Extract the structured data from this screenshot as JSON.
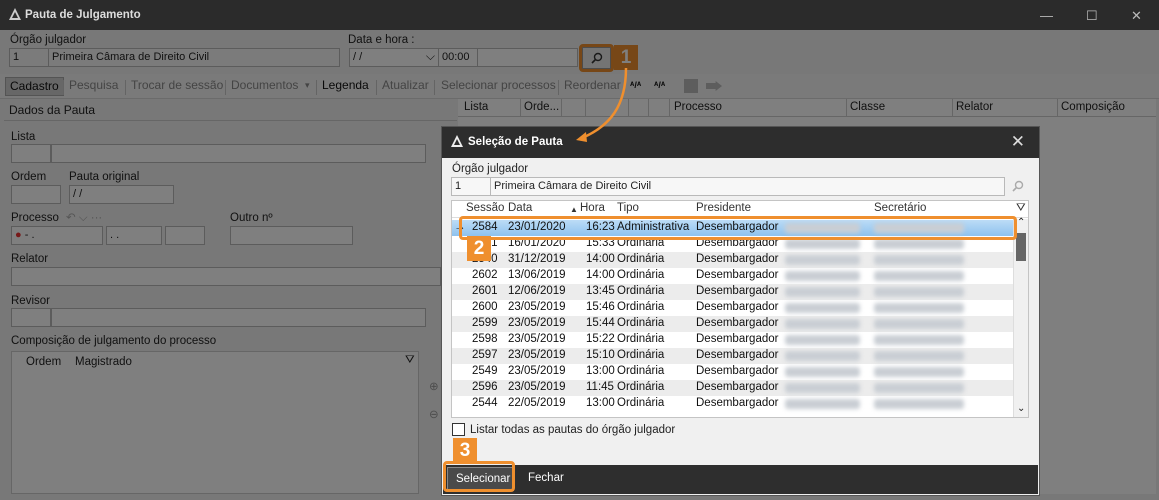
{
  "window": {
    "title": "Pauta de Julgamento"
  },
  "form": {
    "orgao_label": "Órgão julgador",
    "orgao_code": "1",
    "orgao_name": "Primeira Câmara de Direito Civil",
    "data_hora_label": "Data e hora :",
    "date_value": "/ /",
    "time_value": "00:00"
  },
  "toolbar": {
    "items": [
      "Cadastro",
      "Pesquisa",
      "Trocar de sessão",
      "Documentos",
      "Legenda",
      "Atualizar",
      "Selecionar processos",
      "Reordenar"
    ]
  },
  "grid": {
    "columns": [
      "Lista",
      "Orde...",
      "Processo",
      "Classe",
      "Relator",
      "Composição"
    ]
  },
  "left": {
    "section_title": "Dados da Pauta",
    "lista": "Lista",
    "ordem": "Ordem",
    "pauta_original": "Pauta original",
    "pauta_date": "/ /",
    "processo": "Processo",
    "outro_no": "Outro nº",
    "proc_val1": "- .",
    "proc_val2": ". .",
    "relator": "Relator",
    "revisor": "Revisor",
    "composicao": "Composição de julgamento do processo",
    "comp_cols": [
      "Ordem",
      "Magistrado"
    ]
  },
  "dialog": {
    "title": "Seleção de Pauta",
    "orgao_label": "Órgão julgador",
    "orgao_code": "1",
    "orgao_name": "Primeira Câmara de Direito Civil",
    "columns": [
      "Sessão",
      "Data",
      "Hora",
      "Tipo",
      "Presidente",
      "Secretário"
    ],
    "rows": [
      {
        "sessao": "2584",
        "data": "23/01/2020",
        "hora": "16:23",
        "tipo": "Administrativa",
        "presidente": "Desembargador"
      },
      {
        "sessao": "2581",
        "data": "16/01/2020",
        "hora": "15:33",
        "tipo": "Ordinária",
        "presidente": "Desembargador"
      },
      {
        "sessao": "2540",
        "data": "31/12/2019",
        "hora": "14:00",
        "tipo": "Ordinária",
        "presidente": "Desembargador"
      },
      {
        "sessao": "2602",
        "data": "13/06/2019",
        "hora": "14:00",
        "tipo": "Ordinária",
        "presidente": "Desembargador"
      },
      {
        "sessao": "2601",
        "data": "12/06/2019",
        "hora": "13:45",
        "tipo": "Ordinária",
        "presidente": "Desembargador"
      },
      {
        "sessao": "2600",
        "data": "23/05/2019",
        "hora": "15:46",
        "tipo": "Ordinária",
        "presidente": "Desembargador"
      },
      {
        "sessao": "2599",
        "data": "23/05/2019",
        "hora": "15:44",
        "tipo": "Ordinária",
        "presidente": "Desembargador"
      },
      {
        "sessao": "2598",
        "data": "23/05/2019",
        "hora": "15:22",
        "tipo": "Ordinária",
        "presidente": "Desembargador"
      },
      {
        "sessao": "2597",
        "data": "23/05/2019",
        "hora": "15:10",
        "tipo": "Ordinária",
        "presidente": "Desembargador"
      },
      {
        "sessao": "2549",
        "data": "23/05/2019",
        "hora": "13:00",
        "tipo": "Ordinária",
        "presidente": "Desembargador"
      },
      {
        "sessao": "2596",
        "data": "23/05/2019",
        "hora": "11:45",
        "tipo": "Ordinária",
        "presidente": "Desembargador"
      },
      {
        "sessao": "2544",
        "data": "22/05/2019",
        "hora": "13:00",
        "tipo": "Ordinária",
        "presidente": "Desembargador"
      }
    ],
    "checkbox_label": "Listar todas as pautas do órgão julgador",
    "select_button": "Selecionar",
    "close_button": "Fechar"
  },
  "callouts": [
    "1",
    "2",
    "3"
  ],
  "colors": {
    "accent": "#ef8f2e",
    "titlebar": "#2b2b2b",
    "selection": "#9ecbf0"
  }
}
